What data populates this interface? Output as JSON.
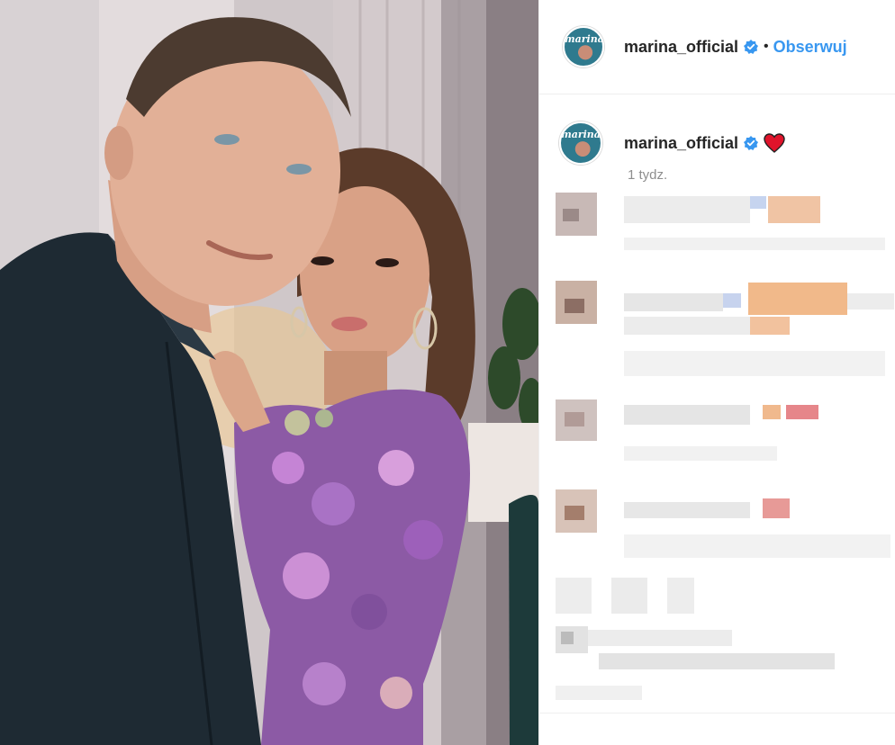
{
  "post": {
    "author": {
      "username": "marina_official",
      "avatar_logo": "marina",
      "verified": true
    },
    "header": {
      "separator": "•",
      "follow_label": "Obserwuj"
    },
    "caption": {
      "emoji": "heart-emoji"
    },
    "timestamp": "1 tydz."
  },
  "colors": {
    "link": "#3897f0",
    "verified": "#3897f0",
    "heart": "#e0142b",
    "muted": "#8e8e8e",
    "divider": "#efefef"
  },
  "comments_state": "pixelated"
}
